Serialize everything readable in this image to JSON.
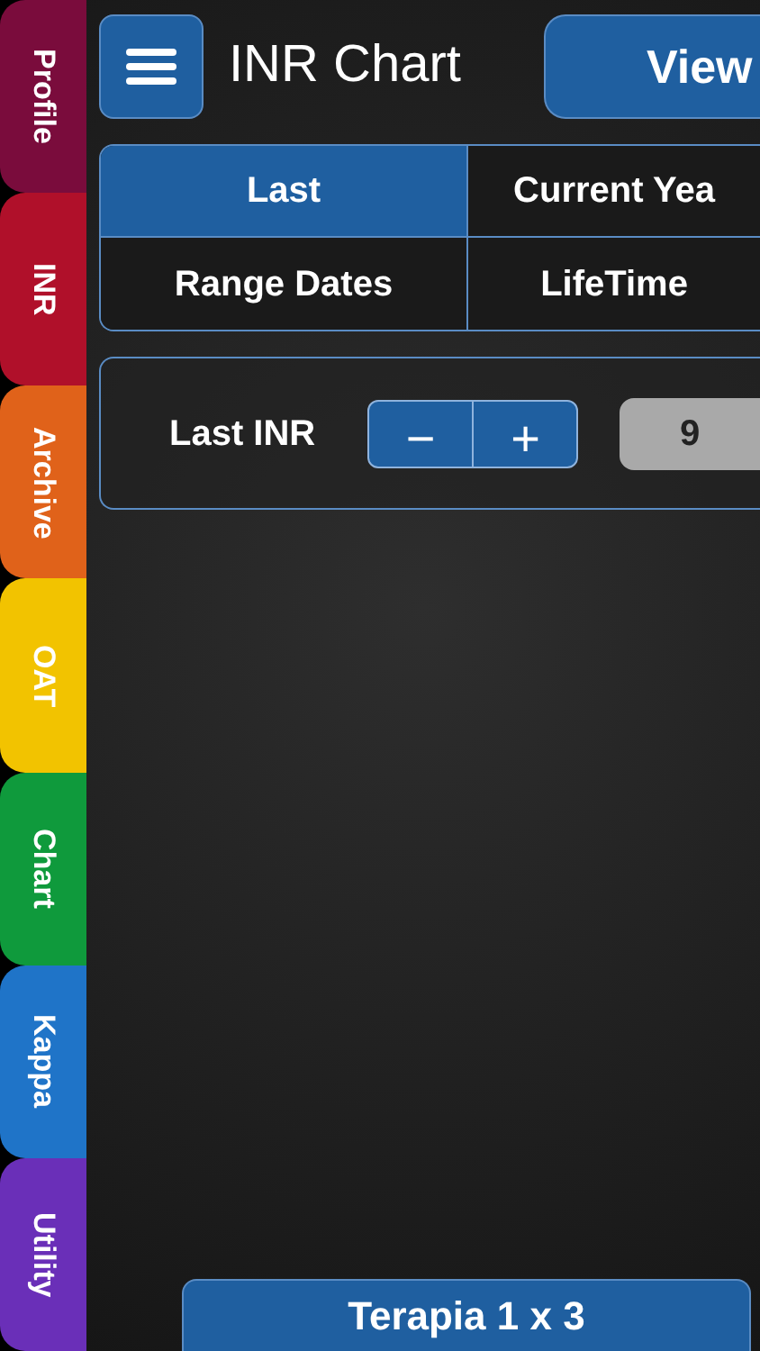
{
  "sidebar": {
    "items": [
      {
        "label": "Profile",
        "color": "#7a0c3c"
      },
      {
        "label": "INR",
        "color": "#b0102a"
      },
      {
        "label": "Archive",
        "color": "#e0621a"
      },
      {
        "label": "OAT",
        "color": "#f2c300"
      },
      {
        "label": "Chart",
        "color": "#0f9a3c"
      },
      {
        "label": "Kappa",
        "color": "#1f74c8"
      },
      {
        "label": "Utility",
        "color": "#6a2fb8"
      }
    ]
  },
  "header": {
    "title": "INR Chart",
    "view_button": "View"
  },
  "period_tabs": [
    {
      "label": "Last",
      "selected": true
    },
    {
      "label": "Current Yea",
      "selected": false
    },
    {
      "label": "Range Dates",
      "selected": false
    },
    {
      "label": "LifeTime",
      "selected": false
    }
  ],
  "last_inr": {
    "label": "Last INR",
    "minus": "−",
    "plus": "+",
    "value": "9"
  },
  "bottom_button": "Terapia 1 x 3"
}
